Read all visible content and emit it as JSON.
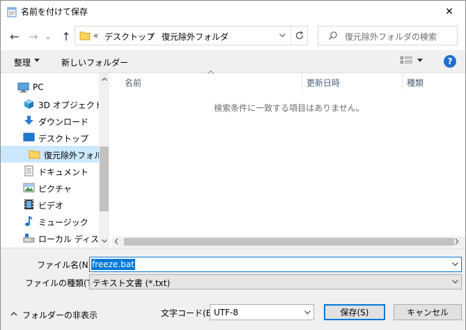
{
  "window": {
    "title": "名前を付けて保存",
    "close_glyph": "✕"
  },
  "nav": {
    "back_glyph": "←",
    "forward_glyph": "→",
    "recent_glyph": "⌄",
    "up_glyph": "↑"
  },
  "address": {
    "overflow_glyph": "«",
    "segments": [
      "デスクトップ",
      "復元除外フォルダ"
    ],
    "separator": "›"
  },
  "search": {
    "placeholder": "復元除外フォルダの検索"
  },
  "toolbar": {
    "organize_label": "整理",
    "new_folder_label": "新しいフォルダー",
    "help_label": "?"
  },
  "nav_pane": {
    "items": [
      {
        "label": "PC",
        "icon": "pc-icon"
      },
      {
        "label": "3D オブジェクト",
        "icon": "3d-objects-icon"
      },
      {
        "label": "ダウンロード",
        "icon": "download-icon"
      },
      {
        "label": "デスクトップ",
        "icon": "desktop-icon"
      },
      {
        "label": "復元除外フォルダ",
        "icon": "folder-icon"
      },
      {
        "label": "ドキュメント",
        "icon": "document-icon"
      },
      {
        "label": "ピクチャ",
        "icon": "pictures-icon"
      },
      {
        "label": "ビデオ",
        "icon": "video-icon"
      },
      {
        "label": "ミュージック",
        "icon": "music-icon"
      },
      {
        "label": "ローカル ディスク (C",
        "icon": "disk-icon"
      }
    ]
  },
  "file_list": {
    "columns": [
      "名前",
      "更新日時",
      "種類"
    ],
    "empty_message": "検索条件に一致する項目はありません。"
  },
  "form": {
    "filename_label": "ファイル名(N):",
    "filename_value": "freeze.bat",
    "filetype_label": "ファイルの種類(T):",
    "filetype_value": "テキスト文書 (*.txt)",
    "hide_folders_label": "フォルダーの非表示",
    "encoding_label": "文字コード(E):",
    "encoding_value": "UTF-8",
    "save_label": "保存(S)",
    "cancel_label": "キャンセル"
  },
  "colors": {
    "accent": "#0078d7",
    "selection": "#cce8ff",
    "folder": "#ffd35c",
    "panel": "#f0f0f0"
  }
}
